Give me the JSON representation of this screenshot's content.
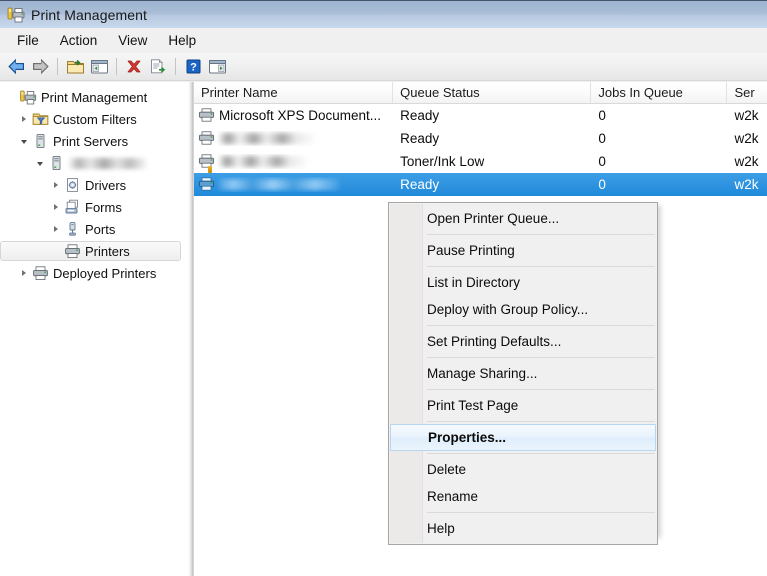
{
  "window": {
    "title": "Print Management",
    "icon": "print-management-icon"
  },
  "menubar": {
    "items": [
      {
        "label": "File"
      },
      {
        "label": "Action"
      },
      {
        "label": "View"
      },
      {
        "label": "Help"
      }
    ]
  },
  "toolbar": {
    "buttons": [
      {
        "name": "back-icon",
        "tip": "Back"
      },
      {
        "name": "forward-icon",
        "tip": "Forward"
      },
      {
        "name": "show-folder-icon",
        "tip": "Up One Level"
      },
      {
        "name": "show-console-tree-icon",
        "tip": "Show/Hide Console Tree"
      },
      {
        "name": "delete-icon",
        "tip": "Delete"
      },
      {
        "name": "export-list-icon",
        "tip": "Export List"
      },
      {
        "name": "help-icon",
        "tip": "Help"
      },
      {
        "name": "show-action-pane-icon",
        "tip": "Show/Hide Action Pane"
      }
    ]
  },
  "tree": {
    "nodes": [
      {
        "label": "Print Management",
        "icon": "print-management-icon",
        "indent": 0,
        "twisty": "none",
        "selected": false,
        "blurred": false
      },
      {
        "label": "Custom Filters",
        "icon": "filter-folder-icon",
        "indent": 1,
        "twisty": "collapsed",
        "selected": false,
        "blurred": false
      },
      {
        "label": "Print Servers",
        "icon": "server-icon",
        "indent": 1,
        "twisty": "expanded",
        "selected": false,
        "blurred": false
      },
      {
        "label": "",
        "icon": "server-icon",
        "indent": 2,
        "twisty": "expanded",
        "selected": false,
        "blurred": true
      },
      {
        "label": "Drivers",
        "icon": "drivers-icon",
        "indent": 3,
        "twisty": "collapsed",
        "selected": false,
        "blurred": false
      },
      {
        "label": "Forms",
        "icon": "forms-icon",
        "indent": 3,
        "twisty": "collapsed",
        "selected": false,
        "blurred": false
      },
      {
        "label": "Ports",
        "icon": "ports-icon",
        "indent": 3,
        "twisty": "collapsed",
        "selected": false,
        "blurred": false
      },
      {
        "label": "Printers",
        "icon": "printer-icon",
        "indent": 3,
        "twisty": "none",
        "selected": true,
        "blurred": false
      },
      {
        "label": "Deployed Printers",
        "icon": "printer-icon",
        "indent": 1,
        "twisty": "collapsed",
        "selected": false,
        "blurred": false
      }
    ]
  },
  "list": {
    "columns": [
      {
        "label": "Printer Name"
      },
      {
        "label": "Queue Status"
      },
      {
        "label": "Jobs In Queue"
      },
      {
        "label": "Ser"
      }
    ],
    "rows": [
      {
        "name": "Microsoft XPS Document...",
        "blurred": false,
        "blur_width": 0,
        "status": "Ready",
        "jobs": "0",
        "server": "w2k",
        "selected": false,
        "toner_warning": false
      },
      {
        "name": "",
        "blurred": true,
        "blur_width": 96,
        "status": "Ready",
        "jobs": "0",
        "server": "w2k",
        "selected": false,
        "toner_warning": false
      },
      {
        "name": "",
        "blurred": true,
        "blur_width": 88,
        "status": "Toner/Ink Low",
        "jobs": "0",
        "server": "w2k",
        "selected": false,
        "toner_warning": true
      },
      {
        "name": "",
        "blurred": true,
        "blur_width": 120,
        "status": "Ready",
        "jobs": "0",
        "server": "w2k",
        "selected": true,
        "toner_warning": false
      }
    ]
  },
  "context_menu": {
    "items": [
      {
        "label": "Open Printer Queue...",
        "highlighted": false,
        "separator_after": true
      },
      {
        "label": "Pause Printing",
        "highlighted": false,
        "separator_after": true
      },
      {
        "label": "List in Directory",
        "highlighted": false,
        "separator_after": false
      },
      {
        "label": "Deploy with Group Policy...",
        "highlighted": false,
        "separator_after": true
      },
      {
        "label": "Set Printing Defaults...",
        "highlighted": false,
        "separator_after": true
      },
      {
        "label": "Manage Sharing...",
        "highlighted": false,
        "separator_after": true
      },
      {
        "label": "Print Test Page",
        "highlighted": false,
        "separator_after": true
      },
      {
        "label": "Properties...",
        "highlighted": true,
        "separator_after": true
      },
      {
        "label": "Delete",
        "highlighted": false,
        "separator_after": false
      },
      {
        "label": "Rename",
        "highlighted": false,
        "separator_after": true
      },
      {
        "label": "Help",
        "highlighted": false,
        "separator_after": false
      }
    ]
  },
  "colors": {
    "titlebar_top": "#9eb4d0",
    "titlebar_bottom": "#c9d9ec",
    "selection_blue": "#2f93e0",
    "menu_bg": "#f1f0f0",
    "highlight_border": "#b8d6ef"
  }
}
